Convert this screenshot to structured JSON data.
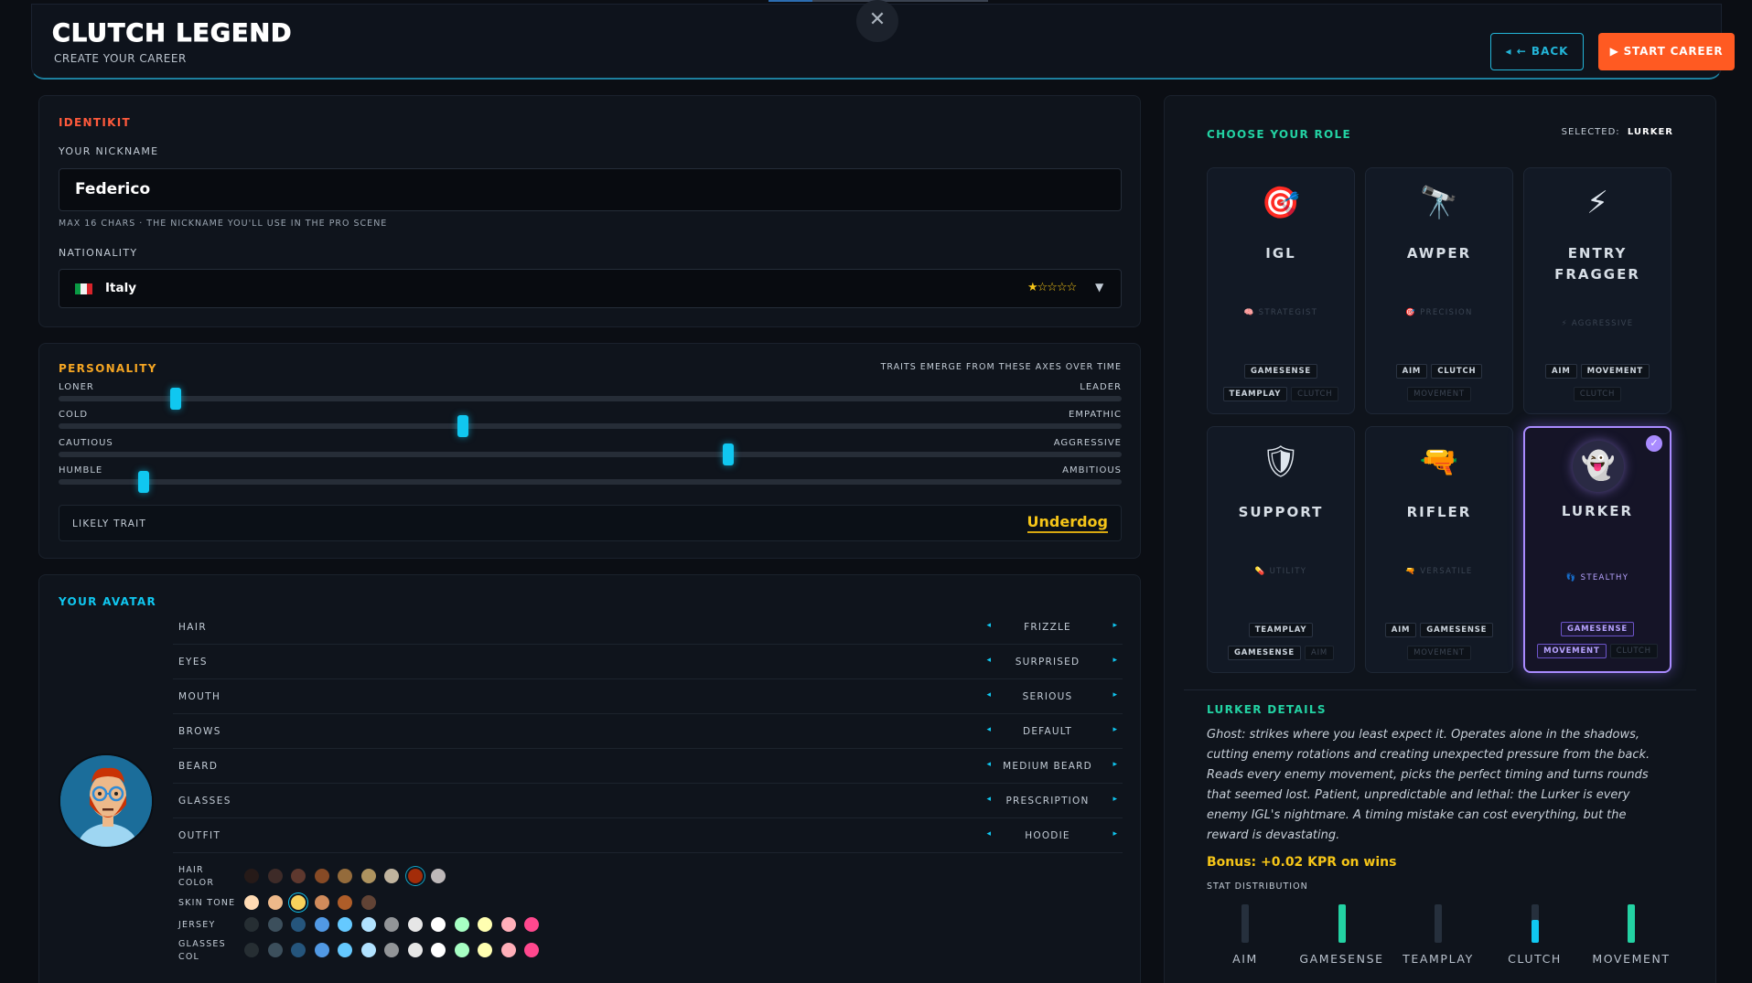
{
  "app": {
    "title": "CLUTCH LEGEND",
    "subtitle": "CREATE YOUR CAREER",
    "progress": 0.2
  },
  "header": {
    "close_label": "✕",
    "back_label": "◂ ← BACK",
    "start_label": "▶ START CAREER"
  },
  "identikit": {
    "section_title": "IDENTIKIT",
    "nickname_label": "YOUR NICKNAME",
    "nickname_value": "Federico",
    "nickname_hint": "MAX 16 CHARS · THE NICKNAME YOU'LL USE IN THE PRO SCENE",
    "nationality_label": "NATIONALITY",
    "nationality_value": "Italy",
    "nationality_stars": "★☆☆☆☆",
    "nationality_rating": 1,
    "dropdown_arrow": "▼"
  },
  "personality": {
    "section_title": "PERSONALITY",
    "hint": "TRAITS EMERGE FROM THESE AXES OVER TIME",
    "axes": [
      {
        "left": "LONER",
        "right": "LEADER",
        "value": 0.11
      },
      {
        "left": "COLD",
        "right": "EMPATHIC",
        "value": 0.38
      },
      {
        "left": "CAUTIOUS",
        "right": "AGGRESSIVE",
        "value": 0.63
      },
      {
        "left": "HUMBLE",
        "right": "AMBITIOUS",
        "value": 0.08
      }
    ],
    "trait_label": "LIKELY TRAIT",
    "trait_value": "Underdog"
  },
  "avatar": {
    "section_title": "YOUR AVATAR",
    "options": [
      {
        "name": "HAIR",
        "value": "FRIZZLE"
      },
      {
        "name": "EYES",
        "value": "SURPRISED"
      },
      {
        "name": "MOUTH",
        "value": "SERIOUS"
      },
      {
        "name": "BROWS",
        "value": "DEFAULT"
      },
      {
        "name": "BEARD",
        "value": "MEDIUM BEARD"
      },
      {
        "name": "GLASSES",
        "value": "PRESCRIPTION"
      },
      {
        "name": "OUTFIT",
        "value": "HOODIE"
      }
    ],
    "arrow_left": "◂",
    "arrow_right": "▸",
    "palettes": [
      {
        "label1": "HAIR",
        "label2": "COLOR",
        "selected": 7,
        "colors": [
          "#2c1b18",
          "#4a312c",
          "#724133",
          "#a55728",
          "#b58143",
          "#d6b370",
          "#ecdcbf",
          "#c93305",
          "#e8e1e1"
        ]
      },
      {
        "label1": "SKIN TONE",
        "label2": "",
        "selected": 2,
        "colors": [
          "#ffdbb4",
          "#edb98a",
          "#f8d25c",
          "#d08b5b",
          "#ae5d29",
          "#614335"
        ]
      },
      {
        "label1": "JERSEY",
        "label2": "",
        "selected": -1,
        "colors": [
          "#262e33",
          "#3c4f5c",
          "#25557c",
          "#5199e4",
          "#65c9ff",
          "#b1e2ff",
          "#929598",
          "#e6e6e6",
          "#ffffff",
          "#a7ffc4",
          "#ffffb1",
          "#ffafb9",
          "#ff488e"
        ]
      },
      {
        "label1": "GLASSES",
        "label2": "COL",
        "selected": -1,
        "colors": [
          "#262e33",
          "#3c4f5c",
          "#25557c",
          "#5199e4",
          "#65c9ff",
          "#b1e2ff",
          "#929598",
          "#e6e6e6",
          "#ffffff",
          "#a7ffc4",
          "#ffffb1",
          "#ffafb9",
          "#ff488e"
        ]
      }
    ]
  },
  "roles": {
    "section_title": "CHOOSE YOUR ROLE",
    "selected_label": "SELECTED:",
    "selected_value": "LURKER",
    "check": "✓",
    "cards": [
      {
        "name": "IGL",
        "icon": "🎯",
        "icon_name": "target-icon",
        "sub": "🧠 STRATEGIST",
        "tags_row1": [
          {
            "t": "GAMESENSE",
            "dim": false
          }
        ],
        "tags_row2": [
          {
            "t": "TEAMPLAY",
            "dim": false
          },
          {
            "t": "CLUTCH",
            "dim": true
          }
        ]
      },
      {
        "name": "AWPER",
        "icon": "🔭",
        "icon_name": "scope-icon",
        "sub": "🎯 PRECISION",
        "tags_row1": [
          {
            "t": "AIM",
            "dim": false
          },
          {
            "t": "CLUTCH",
            "dim": false
          }
        ],
        "tags_row2": [
          {
            "t": "MOVEMENT",
            "dim": true
          }
        ]
      },
      {
        "name": "ENTRY FRAGGER",
        "icon": "⚡",
        "icon_name": "lightning-icon",
        "sub": "⚡ AGGRESSIVE",
        "tags_row1": [
          {
            "t": "AIM",
            "dim": false
          },
          {
            "t": "MOVEMENT",
            "dim": false
          }
        ],
        "tags_row2": [
          {
            "t": "CLUTCH",
            "dim": true
          }
        ]
      },
      {
        "name": "SUPPORT",
        "icon": "🛡",
        "icon_name": "shield-icon",
        "sub": "💊 UTILITY",
        "tags_row1": [
          {
            "t": "TEAMPLAY",
            "dim": false
          }
        ],
        "tags_row2": [
          {
            "t": "GAMESENSE",
            "dim": false
          },
          {
            "t": "AIM",
            "dim": true
          }
        ]
      },
      {
        "name": "RIFLER",
        "icon": "🔫",
        "icon_name": "rifle-icon",
        "sub": "🔫 VERSATILE",
        "tags_row1": [
          {
            "t": "AIM",
            "dim": false
          },
          {
            "t": "GAMESENSE",
            "dim": false
          }
        ],
        "tags_row2": [
          {
            "t": "MOVEMENT",
            "dim": true
          }
        ]
      },
      {
        "name": "LURKER",
        "icon": "👻",
        "icon_name": "ghost-icon",
        "sub": "👣 STEALTHY",
        "tags_row1": [
          {
            "t": "GAMESENSE",
            "dim": false
          }
        ],
        "tags_row2": [
          {
            "t": "MOVEMENT",
            "dim": false
          },
          {
            "t": "CLUTCH",
            "dim": true
          }
        ]
      }
    ]
  },
  "details": {
    "title": "LURKER DETAILS",
    "description": "Ghost: strikes where you least expect it. Operates alone in the shadows, cutting enemy rotations and creating unexpected pressure from the back. Reads every enemy movement, picks the perfect timing and turns rounds that seemed lost. Patient, unpredictable and lethal: the Lurker is every enemy IGL's nightmare. A timing mistake can cost everything, but the reward is devastating.",
    "bonus": "Bonus: +0.02 KPR on wins",
    "stat_title": "STAT DISTRIBUTION",
    "stats": [
      {
        "name": "AIM",
        "value": 0.0,
        "color": "#26303d"
      },
      {
        "name": "GAMESENSE",
        "value": 1.0,
        "color": "#23d2a3"
      },
      {
        "name": "TEAMPLAY",
        "value": 0.0,
        "color": "#26303d"
      },
      {
        "name": "CLUTCH",
        "value": 0.6,
        "color": "#10c7f0"
      },
      {
        "name": "MOVEMENT",
        "value": 1.0,
        "color": "#23d2a3"
      }
    ]
  }
}
